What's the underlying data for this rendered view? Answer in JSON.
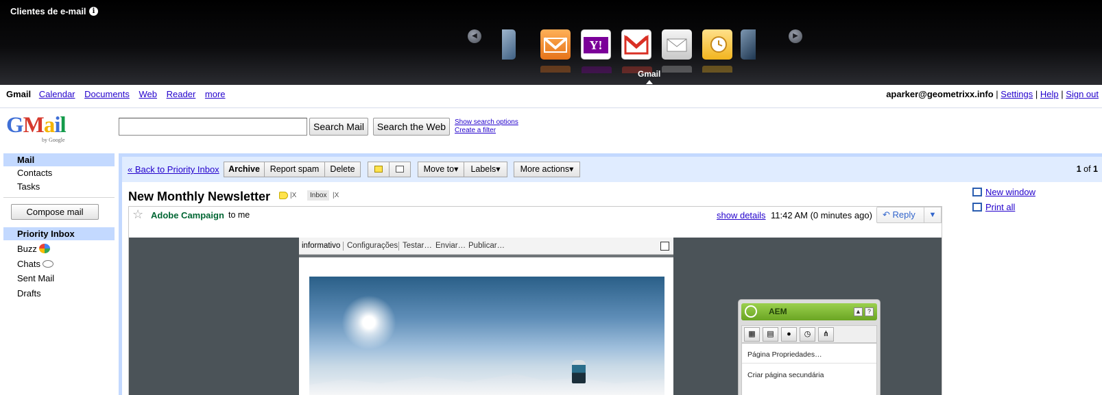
{
  "topbar": {
    "title": "Clientes de e-mail",
    "info_icon": "info-icon",
    "prev_icon": "arrow-left-icon",
    "next_icon": "arrow-right-icon",
    "clients": [
      {
        "name": "partial-client-left",
        "color": "#5b7fa8"
      },
      {
        "name": "orange-mail-client",
        "color": "#f08a24"
      },
      {
        "name": "yahoo-mail-client",
        "color": "#7b0099"
      },
      {
        "name": "gmail-client",
        "color": "#e33b2e"
      },
      {
        "name": "generic-mail-client",
        "color": "#c9c9c9"
      },
      {
        "name": "outlook-mail-client",
        "color": "#f5c13a"
      },
      {
        "name": "partial-client-right",
        "color": "#4a6a8a"
      }
    ],
    "selected_label": "Gmail"
  },
  "nav": {
    "brand": "Gmail",
    "links": [
      "Calendar",
      "Documents",
      "Web",
      "Reader",
      "more"
    ],
    "user": "aparker@geometrixx.info",
    "sep": "|",
    "settings": "Settings",
    "help": "Help",
    "signout": "Sign out"
  },
  "logo": {
    "wordmark_g": "G",
    "wordmark_m": "M",
    "wordmark_a": "a",
    "wordmark_i": "i",
    "wordmark_l": "l",
    "by": "by Google"
  },
  "search": {
    "value": "",
    "mail_btn": "Search Mail",
    "web_btn": "Search the Web",
    "options": "Show search options",
    "filter": "Create a filter"
  },
  "sidebar": {
    "mail": "Mail",
    "contacts": "Contacts",
    "tasks": "Tasks",
    "compose": "Compose mail",
    "priority": "Priority Inbox",
    "buzz": "Buzz",
    "chats": "Chats",
    "sent": "Sent Mail",
    "drafts": "Drafts"
  },
  "toolbar": {
    "back": "« Back to Priority Inbox",
    "archive": "Archive",
    "spam": "Report spam",
    "delete": "Delete",
    "move": "Move to▾",
    "labels": "Labels▾",
    "more": "More actions▾",
    "pager_current": "1",
    "pager_of": "of",
    "pager_total": "1"
  },
  "message": {
    "subject": "New Monthly Newsletter",
    "inbox_label": "Inbox",
    "label_x": "X",
    "sender": "Adobe Campaign",
    "to": "to me",
    "show_details": "show details",
    "time": "11:42 AM (0 minutes ago)",
    "reply": "Reply",
    "reply_menu": "▼"
  },
  "editor": {
    "tabs": [
      "informativo",
      "Configurações",
      "Testar…",
      "Enviar…",
      "Publicar…"
    ]
  },
  "aem": {
    "title": "AEM",
    "collapse": "▲",
    "help": "?",
    "tab_icons": [
      "components-icon",
      "page-icon",
      "lock-icon",
      "clock-icon",
      "workflow-icon"
    ],
    "entries": [
      "Página Propriedades…",
      "Criar página secundária"
    ]
  },
  "right_links": {
    "new_window": "New window",
    "print_all": "Print all"
  }
}
